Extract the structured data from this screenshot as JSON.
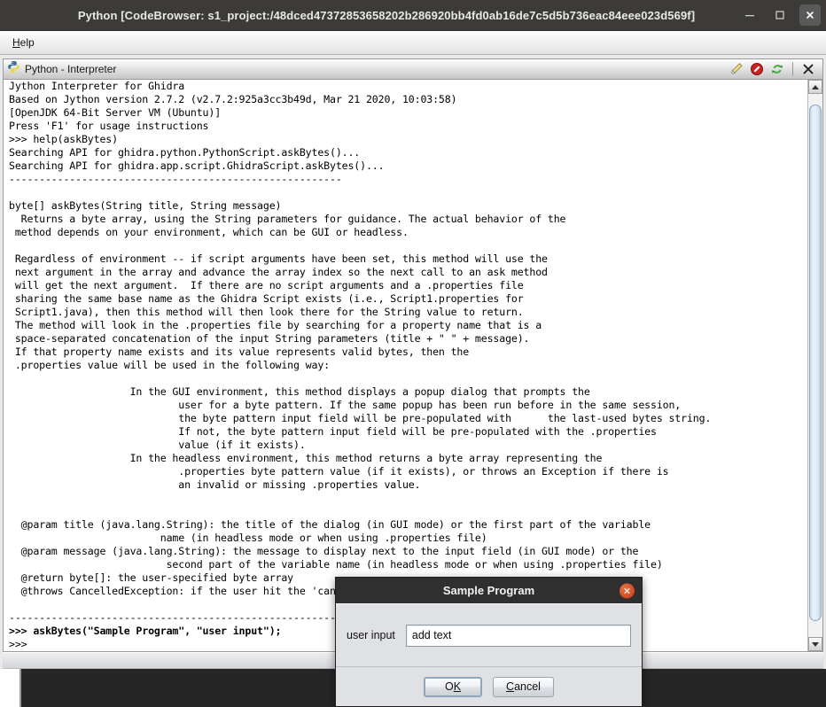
{
  "window": {
    "title": "Python [CodeBrowser: s1_project:/48dced47372853658202b286920bb4fd0ab16de7c5d5b736eac84eee023d569f]",
    "minimize_label": "—",
    "maximize_label": "□",
    "close_label": "✕"
  },
  "menubar": {
    "items": [
      {
        "label": "Help",
        "mnemonic": "H"
      }
    ]
  },
  "panel": {
    "icon": "python-logo-icon",
    "title": "Python - Interpreter",
    "tools": [
      {
        "name": "highlight-pencil-icon",
        "tooltip": "Select Font"
      },
      {
        "name": "cancel-stop-icon",
        "tooltip": "Interrupt"
      },
      {
        "name": "refresh-reset-icon",
        "tooltip": "Reset Interpreter"
      },
      {
        "name": "close-panel-icon",
        "tooltip": "Close"
      }
    ]
  },
  "console": {
    "text": "Jython Interpreter for Ghidra\nBased on Jython version 2.7.2 (v2.7.2:925a3cc3b49d, Mar 21 2020, 10:03:58)\n[OpenJDK 64-Bit Server VM (Ubuntu)]\nPress 'F1' for usage instructions\n>>> help(askBytes)\nSearching API for ghidra.python.PythonScript.askBytes()...\nSearching API for ghidra.app.script.GhidraScript.askBytes()...\n-------------------------------------------------------\n\nbyte[] askBytes(String title, String message)\n  Returns a byte array, using the String parameters for guidance. The actual behavior of the\n method depends on your environment, which can be GUI or headless.\n\n Regardless of environment -- if script arguments have been set, this method will use the\n next argument in the array and advance the array index so the next call to an ask method\n will get the next argument.  If there are no script arguments and a .properties file\n sharing the same base name as the Ghidra Script exists (i.e., Script1.properties for\n Script1.java), then this method will then look there for the String value to return.\n The method will look in the .properties file by searching for a property name that is a\n space-separated concatenation of the input String parameters (title + \" \" + message).\n If that property name exists and its value represents valid bytes, then the\n .properties value will be used in the following way:\n\n                    In the GUI environment, this method displays a popup dialog that prompts the\n                            user for a byte pattern. If the same popup has been run before in the same session,\n                            the byte pattern input field will be pre-populated with      the last-used bytes string.\n                            If not, the byte pattern input field will be pre-populated with the .properties\n                            value (if it exists).\n                    In the headless environment, this method returns a byte array representing the\n                            .properties byte pattern value (if it exists), or throws an Exception if there is\n                            an invalid or missing .properties value.\n\n\n  @param title (java.lang.String): the title of the dialog (in GUI mode) or the first part of the variable\n                         name (in headless mode or when using .properties file)\n  @param message (java.lang.String): the message to display next to the input field (in GUI mode) or the\n                          second part of the variable name (in headless mode or when using .properties file)\n  @return byte[]: the user-specified byte array\n  @throws CancelledException: if the user hit the 'cancel' button in GUI mode\n\n-------------------------------------------------------",
    "prompt_command": ">>> askBytes(\"Sample Program\", \"user input\");",
    "prompt_empty": ">>>"
  },
  "scrollbar": {
    "up_arrow": "scroll-up-icon",
    "down_arrow": "scroll-down-icon",
    "thumb_position_percent": 2,
    "thumb_size_percent": 95
  },
  "dialog": {
    "title": "Sample Program",
    "close_label": "✕",
    "field_label": "user input",
    "field_value": "add text",
    "field_placeholder": "",
    "buttons": [
      {
        "label": "OK",
        "mnemonic": "K",
        "default": true
      },
      {
        "label": "Cancel",
        "mnemonic": "C",
        "default": false
      }
    ]
  },
  "colors": {
    "titlebar_bg": "#3c3b37",
    "dialog_titlebar_bg": "#2f2f2f",
    "dialog_close_accent": "#d0471c",
    "panel_bg": "#dfe1e4",
    "scrollbar_thumb": "#cfe0ee",
    "desktop_bg": "#262626"
  }
}
